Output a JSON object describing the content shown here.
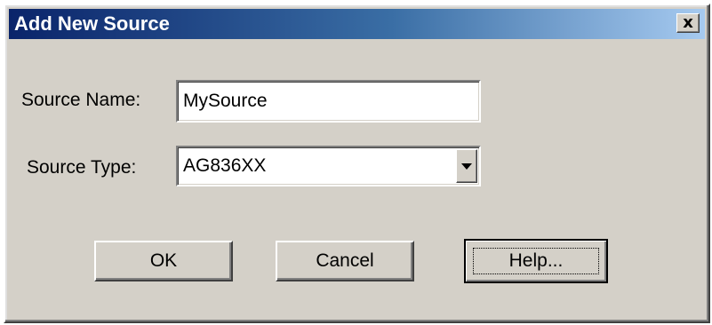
{
  "window": {
    "title": "Add New Source",
    "close_label": "x"
  },
  "form": {
    "source_name_label": "Source Name:",
    "source_name_value": "MySource",
    "source_type_label": "Source Type:",
    "source_type_value": "AG836XX"
  },
  "buttons": {
    "ok": "OK",
    "cancel": "Cancel",
    "help": "Help..."
  }
}
